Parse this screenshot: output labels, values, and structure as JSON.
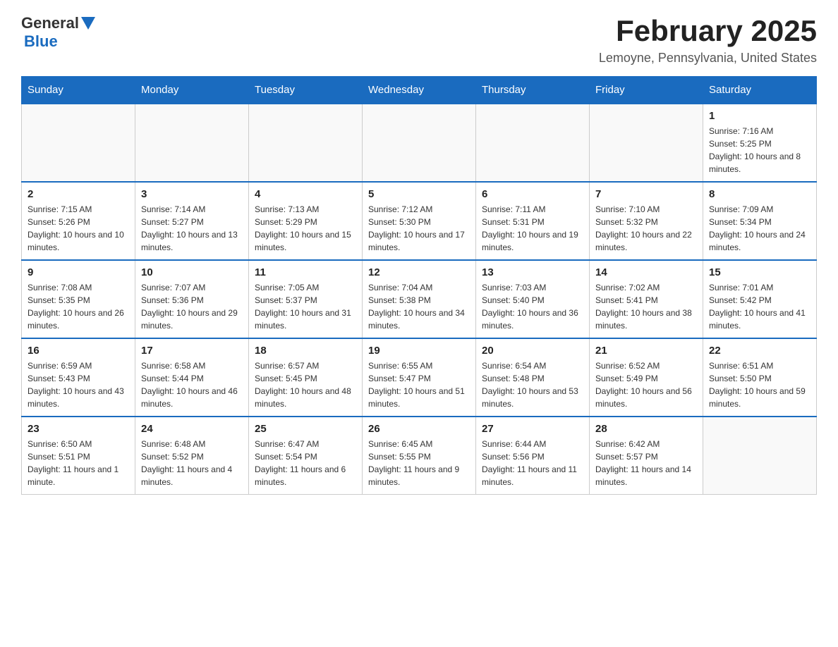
{
  "header": {
    "logo": {
      "general": "General",
      "blue": "Blue"
    },
    "title": "February 2025",
    "location": "Lemoyne, Pennsylvania, United States"
  },
  "calendar": {
    "days_of_week": [
      "Sunday",
      "Monday",
      "Tuesday",
      "Wednesday",
      "Thursday",
      "Friday",
      "Saturday"
    ],
    "weeks": [
      [
        {
          "day": "",
          "info": ""
        },
        {
          "day": "",
          "info": ""
        },
        {
          "day": "",
          "info": ""
        },
        {
          "day": "",
          "info": ""
        },
        {
          "day": "",
          "info": ""
        },
        {
          "day": "",
          "info": ""
        },
        {
          "day": "1",
          "info": "Sunrise: 7:16 AM\nSunset: 5:25 PM\nDaylight: 10 hours and 8 minutes."
        }
      ],
      [
        {
          "day": "2",
          "info": "Sunrise: 7:15 AM\nSunset: 5:26 PM\nDaylight: 10 hours and 10 minutes."
        },
        {
          "day": "3",
          "info": "Sunrise: 7:14 AM\nSunset: 5:27 PM\nDaylight: 10 hours and 13 minutes."
        },
        {
          "day": "4",
          "info": "Sunrise: 7:13 AM\nSunset: 5:29 PM\nDaylight: 10 hours and 15 minutes."
        },
        {
          "day": "5",
          "info": "Sunrise: 7:12 AM\nSunset: 5:30 PM\nDaylight: 10 hours and 17 minutes."
        },
        {
          "day": "6",
          "info": "Sunrise: 7:11 AM\nSunset: 5:31 PM\nDaylight: 10 hours and 19 minutes."
        },
        {
          "day": "7",
          "info": "Sunrise: 7:10 AM\nSunset: 5:32 PM\nDaylight: 10 hours and 22 minutes."
        },
        {
          "day": "8",
          "info": "Sunrise: 7:09 AM\nSunset: 5:34 PM\nDaylight: 10 hours and 24 minutes."
        }
      ],
      [
        {
          "day": "9",
          "info": "Sunrise: 7:08 AM\nSunset: 5:35 PM\nDaylight: 10 hours and 26 minutes."
        },
        {
          "day": "10",
          "info": "Sunrise: 7:07 AM\nSunset: 5:36 PM\nDaylight: 10 hours and 29 minutes."
        },
        {
          "day": "11",
          "info": "Sunrise: 7:05 AM\nSunset: 5:37 PM\nDaylight: 10 hours and 31 minutes."
        },
        {
          "day": "12",
          "info": "Sunrise: 7:04 AM\nSunset: 5:38 PM\nDaylight: 10 hours and 34 minutes."
        },
        {
          "day": "13",
          "info": "Sunrise: 7:03 AM\nSunset: 5:40 PM\nDaylight: 10 hours and 36 minutes."
        },
        {
          "day": "14",
          "info": "Sunrise: 7:02 AM\nSunset: 5:41 PM\nDaylight: 10 hours and 38 minutes."
        },
        {
          "day": "15",
          "info": "Sunrise: 7:01 AM\nSunset: 5:42 PM\nDaylight: 10 hours and 41 minutes."
        }
      ],
      [
        {
          "day": "16",
          "info": "Sunrise: 6:59 AM\nSunset: 5:43 PM\nDaylight: 10 hours and 43 minutes."
        },
        {
          "day": "17",
          "info": "Sunrise: 6:58 AM\nSunset: 5:44 PM\nDaylight: 10 hours and 46 minutes."
        },
        {
          "day": "18",
          "info": "Sunrise: 6:57 AM\nSunset: 5:45 PM\nDaylight: 10 hours and 48 minutes."
        },
        {
          "day": "19",
          "info": "Sunrise: 6:55 AM\nSunset: 5:47 PM\nDaylight: 10 hours and 51 minutes."
        },
        {
          "day": "20",
          "info": "Sunrise: 6:54 AM\nSunset: 5:48 PM\nDaylight: 10 hours and 53 minutes."
        },
        {
          "day": "21",
          "info": "Sunrise: 6:52 AM\nSunset: 5:49 PM\nDaylight: 10 hours and 56 minutes."
        },
        {
          "day": "22",
          "info": "Sunrise: 6:51 AM\nSunset: 5:50 PM\nDaylight: 10 hours and 59 minutes."
        }
      ],
      [
        {
          "day": "23",
          "info": "Sunrise: 6:50 AM\nSunset: 5:51 PM\nDaylight: 11 hours and 1 minute."
        },
        {
          "day": "24",
          "info": "Sunrise: 6:48 AM\nSunset: 5:52 PM\nDaylight: 11 hours and 4 minutes."
        },
        {
          "day": "25",
          "info": "Sunrise: 6:47 AM\nSunset: 5:54 PM\nDaylight: 11 hours and 6 minutes."
        },
        {
          "day": "26",
          "info": "Sunrise: 6:45 AM\nSunset: 5:55 PM\nDaylight: 11 hours and 9 minutes."
        },
        {
          "day": "27",
          "info": "Sunrise: 6:44 AM\nSunset: 5:56 PM\nDaylight: 11 hours and 11 minutes."
        },
        {
          "day": "28",
          "info": "Sunrise: 6:42 AM\nSunset: 5:57 PM\nDaylight: 11 hours and 14 minutes."
        },
        {
          "day": "",
          "info": ""
        }
      ]
    ]
  }
}
